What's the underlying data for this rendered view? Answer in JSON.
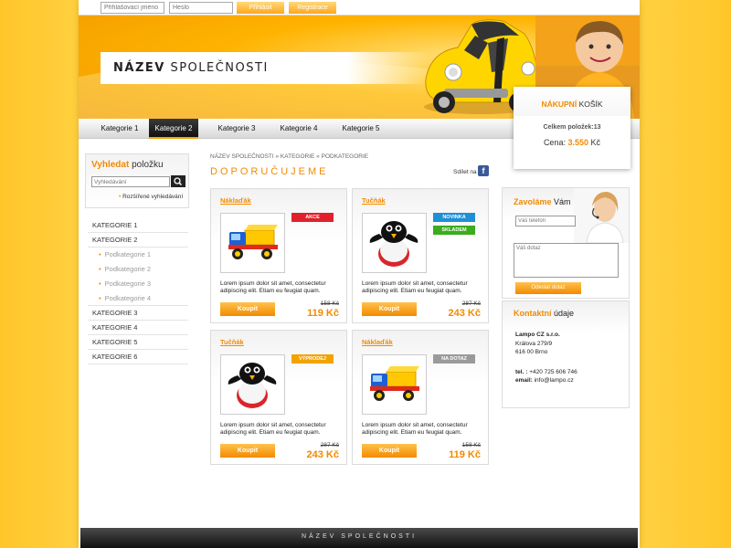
{
  "topbar": {
    "username_placeholder": "Přihlašovací jméno",
    "password_placeholder": "Heslo",
    "login_label": "Přihlásit",
    "register_label": "Registrace"
  },
  "header": {
    "company_bold": "NÁZEV",
    "company_rest": "SPOLEČNOSTI"
  },
  "cart": {
    "title_bold": "NÁKUPNÍ",
    "title_rest": "KOŠÍK",
    "items_label": "Celkem položek:",
    "items_count": "13",
    "price_label": "Cena:",
    "price_value": "3.550",
    "currency": "Kč"
  },
  "nav": {
    "items": [
      {
        "label": "Kategorie 1"
      },
      {
        "label": "Kategorie 2",
        "active": true
      },
      {
        "label": "Kategorie 3"
      },
      {
        "label": "Kategorie 4"
      },
      {
        "label": "Kategorie 5"
      }
    ]
  },
  "search": {
    "title_orange": "Vyhledat",
    "title_rest": "položku",
    "placeholder": "Vyhledávání",
    "advanced_label": "Rozšířené vyhledávání"
  },
  "categories": [
    {
      "label": "KATEGORIE 1",
      "sub": false
    },
    {
      "label": "KATEGORIE 2",
      "sub": false
    },
    {
      "label": "Podkategorie 1",
      "sub": true
    },
    {
      "label": "Podkategorie 2",
      "sub": true
    },
    {
      "label": "Podkategorie 3",
      "sub": true
    },
    {
      "label": "Podkategorie 4",
      "sub": true
    },
    {
      "label": "KATEGORIE 3",
      "sub": false
    },
    {
      "label": "KATEGORIE 4",
      "sub": false
    },
    {
      "label": "KATEGORIE 5",
      "sub": false
    },
    {
      "label": "KATEGORIE 6",
      "sub": false
    }
  ],
  "content": {
    "breadcrumb": "NÁZEV SPOLEČNOSTI » KATEGORIE » PODKATEGORIE",
    "section_title": "DOPORUČUJEME",
    "share_label": "Sdílet na"
  },
  "products": [
    {
      "name": "Náklaďák",
      "image": "truck-image",
      "badges": [
        {
          "label": "AKCE",
          "color": "#e0212b"
        }
      ],
      "desc": "Lorem ipsum dolor sit amet, consectetur adipiscing elit. Etiam eu feugiat quam.",
      "buy": "Koupit",
      "old_price": "158 Kč",
      "price": "119 Kč"
    },
    {
      "name": "Tučňák",
      "image": "penguin-image",
      "badges": [
        {
          "label": "NOVINKA",
          "color": "#1f8fd6"
        },
        {
          "label": "SKLADEM",
          "color": "#3aac1e"
        }
      ],
      "desc": "Lorem ipsum dolor sit amet, consectetur adipiscing elit. Etiam eu feugiat quam.",
      "buy": "Koupit",
      "old_price": "287 Kč",
      "price": "243 Kč"
    },
    {
      "name": "Tučňák",
      "image": "penguin-image",
      "badges": [
        {
          "label": "VÝPRODEJ",
          "color": "#f2a300"
        }
      ],
      "desc": "Lorem ipsum dolor sit amet, consectetur adipiscing elit. Etiam eu feugiat quam.",
      "buy": "Koupit",
      "old_price": "287 Kč",
      "price": "243 Kč"
    },
    {
      "name": "Náklaďák",
      "image": "truck-image",
      "badges": [
        {
          "label": "NA DOTAZ",
          "color": "#9a9a9a"
        }
      ],
      "desc": "Lorem ipsum dolor sit amet, consectetur adipiscing elit. Etiam eu feugiat quam.",
      "buy": "Koupit",
      "old_price": "158 Kč",
      "price": "119 Kč"
    }
  ],
  "call": {
    "title_orange": "Zavoláme",
    "title_rest": "Vám",
    "phone_placeholder": "Váš telefon",
    "question_placeholder": "Váš dotaz",
    "send_label": "Odeslat dotaz"
  },
  "contact": {
    "title_orange": "Kontaktní",
    "title_rest": "údaje",
    "company": "Lampo CZ s.r.o.",
    "street": "Králova 279/9",
    "city": "616 00 Brno",
    "phone_label": "tel. :",
    "phone": "+420 725 606 746",
    "email_label": "email:",
    "email": "info@lampo.cz"
  },
  "footer": {
    "text": "NÁZEV SPOLEČNOSTI"
  },
  "colors": {
    "accent": "#f28a00",
    "background": "#ffcf3d"
  }
}
